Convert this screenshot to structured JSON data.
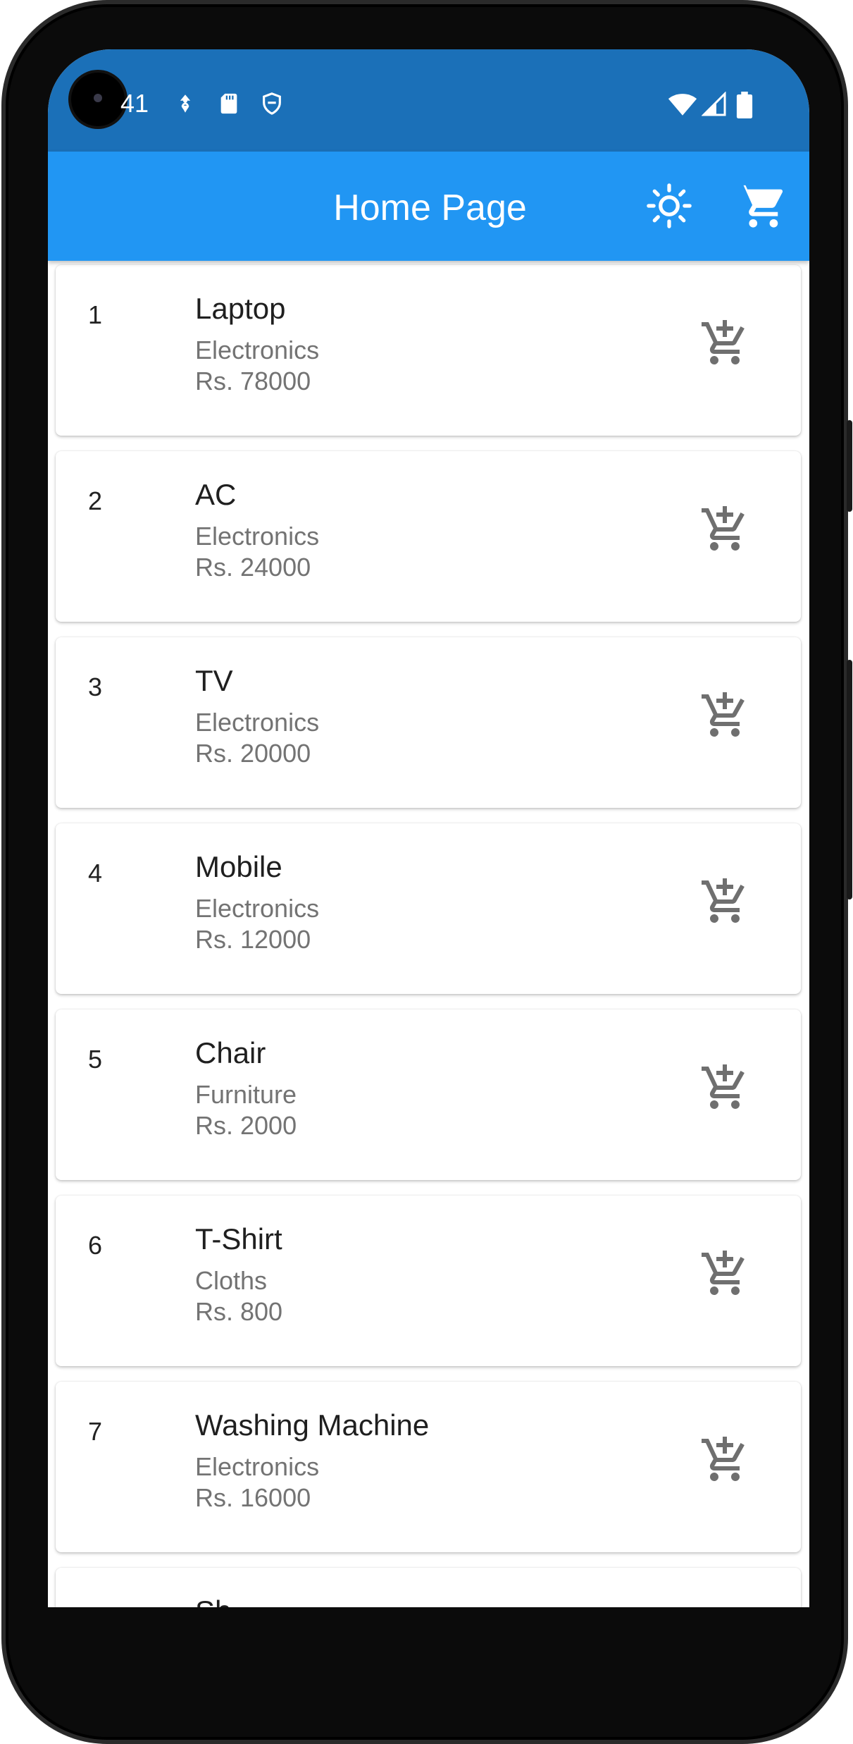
{
  "status_bar": {
    "time": "41",
    "icons": [
      "location-icon",
      "sd-card-icon",
      "shield-icon",
      "wifi-icon",
      "signal-icon",
      "battery-icon"
    ]
  },
  "app_bar": {
    "title": "Home Page",
    "actions": [
      "theme-toggle-sun-icon",
      "shopping-cart-icon"
    ]
  },
  "colors": {
    "app_bar": "#2196f3",
    "status_bar": "#1b70b8",
    "icon_gray": "#6f6f6f"
  },
  "products": [
    {
      "index": "1",
      "name": "Laptop",
      "category": "Electronics",
      "price": "Rs. 78000"
    },
    {
      "index": "2",
      "name": "AC",
      "category": "Electronics",
      "price": "Rs. 24000"
    },
    {
      "index": "3",
      "name": "TV",
      "category": "Electronics",
      "price": "Rs. 20000"
    },
    {
      "index": "4",
      "name": "Mobile",
      "category": "Electronics",
      "price": "Rs. 12000"
    },
    {
      "index": "5",
      "name": "Chair",
      "category": "Furniture",
      "price": "Rs. 2000"
    },
    {
      "index": "6",
      "name": "T-Shirt",
      "category": "Cloths",
      "price": "Rs. 800"
    },
    {
      "index": "7",
      "name": "Washing Machine",
      "category": "Electronics",
      "price": "Rs. 16000"
    },
    {
      "index": "",
      "name": "Sh",
      "category": "",
      "price": ""
    }
  ],
  "nav_bar": [
    "back-icon",
    "home-icon",
    "recents-icon"
  ]
}
